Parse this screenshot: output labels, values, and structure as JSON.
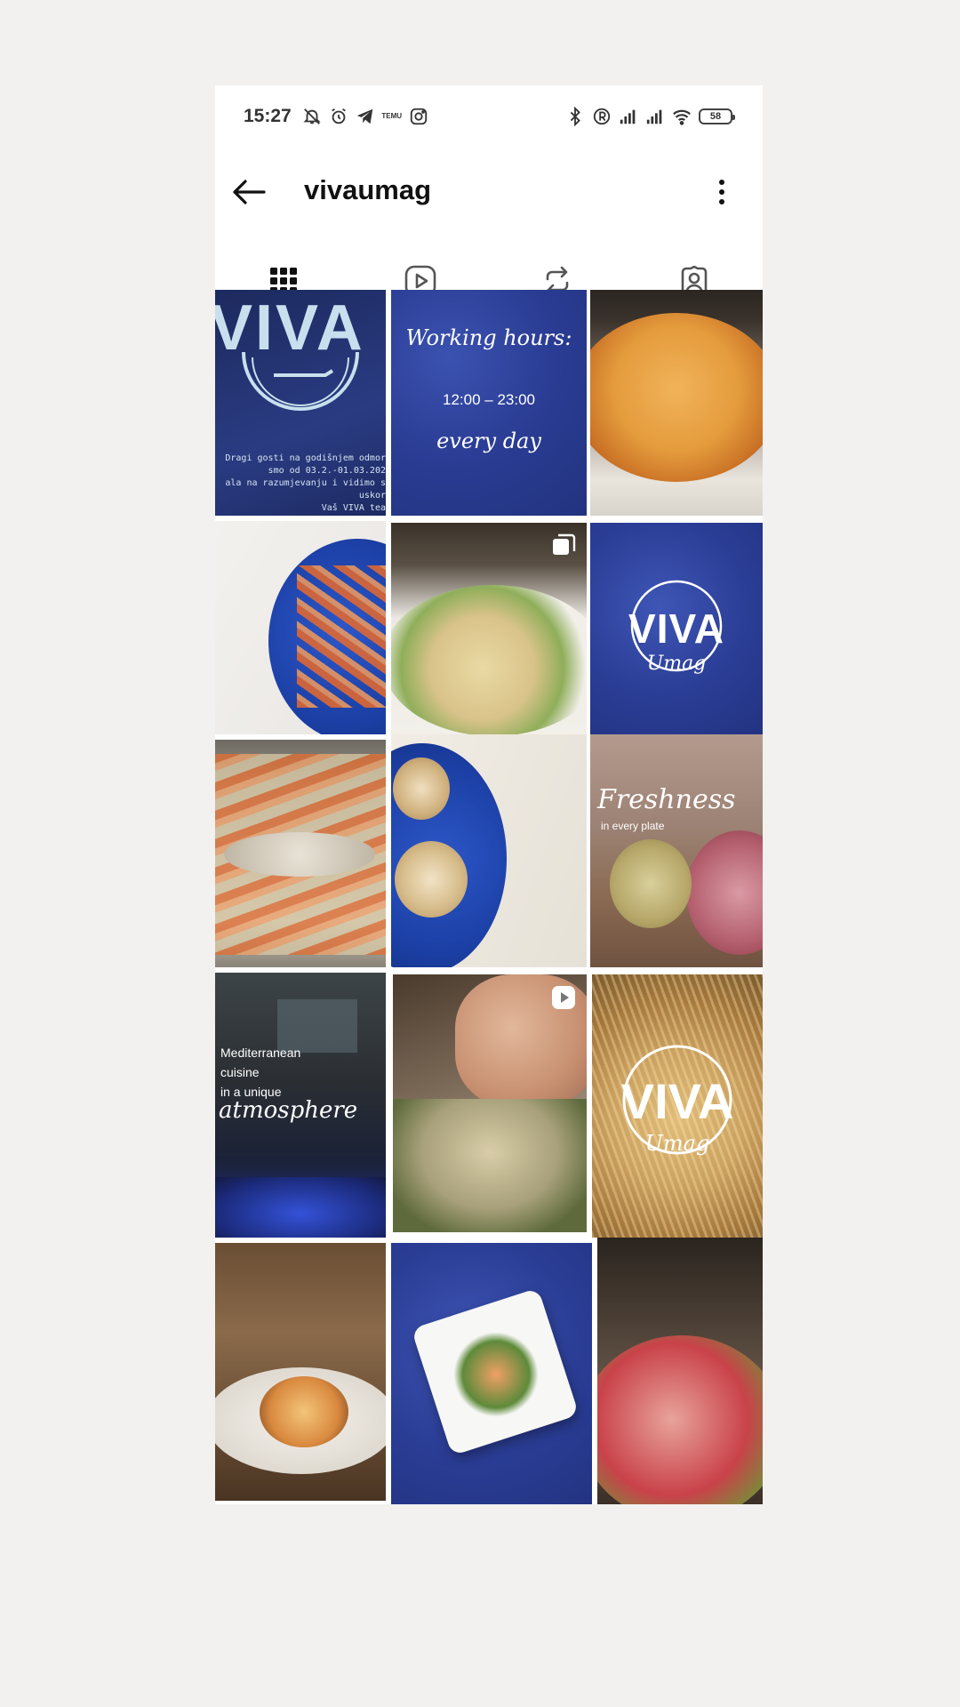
{
  "status_bar": {
    "time": "15:27",
    "temu_label": "TEMU",
    "battery": "58"
  },
  "header": {
    "title": "vivaumag"
  },
  "tabs": [
    {
      "name": "posts",
      "icon": "grid-icon"
    },
    {
      "name": "reels",
      "icon": "play-square-icon"
    },
    {
      "name": "reposts",
      "icon": "repost-icon"
    },
    {
      "name": "tagged",
      "icon": "tagged-user-icon"
    }
  ],
  "posts": {
    "p1": {
      "logo": "VIVA",
      "notice": [
        "Dragi gosti na godišnjem odmor",
        "smo od 03.2.-01.03.202",
        "ala na razumjevanju i vidimo s",
        "uskor",
        "Vaš VIVA tea"
      ]
    },
    "p2": {
      "heading": "Working hours:",
      "hours": "12:00 – 23:00",
      "footer": "every day"
    },
    "p6": {
      "logo": "VIVA",
      "sub": "Umag"
    },
    "p9": {
      "script": "Freshness",
      "sub": "in every plate"
    },
    "p10": {
      "line1": "Mediterranean",
      "line2": "cuisine",
      "line3": "in a unique",
      "script": "atmosphere"
    },
    "p12": {
      "logo": "VIVA",
      "sub": "Umag"
    }
  },
  "colors": {
    "navy": "#1f2f72",
    "deep_blue": "#2b3f98",
    "background": "#f2f1ef"
  }
}
